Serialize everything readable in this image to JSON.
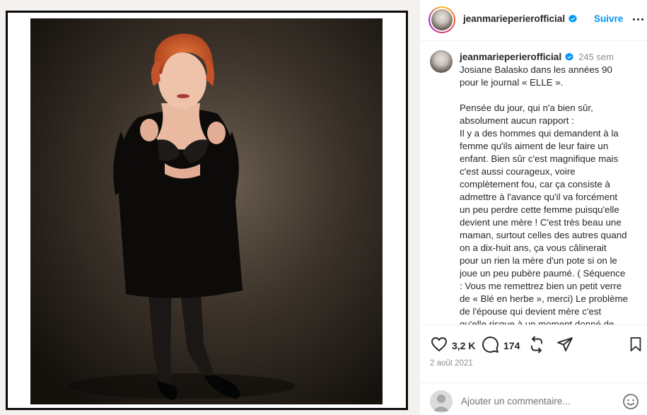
{
  "post": {
    "username": "jeanmarieperierofficial",
    "follow_label": "Suivre",
    "time_ago": "245 sem",
    "caption_lines": [
      "Josiane Balasko dans les années 90",
      "pour le journal « ELLE ».",
      "",
      "Pensée du jour, qui n'a bien sûr,",
      "absolument aucun rapport :",
      "Il y a des hommes qui demandent à la",
      "femme qu'ils aiment de leur faire un",
      "enfant. Bien sûr c'est magnifique mais",
      "c'est aussi courageux, voire",
      "complètement fou, car ça consiste à",
      "admettre à l'avance qu'il va forcément",
      "un peu perdre cette femme puisqu'elle",
      "devient une mère ! C'est très beau une",
      "maman, surtout celles des autres quand",
      "on a dix-huit ans, ça vous câlinerait",
      "pour un rien la mère d'un pote si on le",
      "joue un peu pubère paumé. ( Séquence",
      ": Vous me remettrez bien un petit verre",
      "de « Blé en herbe », merci) Le problème",
      "de l'épouse qui devient mère c'est",
      "qu'elle risque à un moment donné de"
    ],
    "likes": "3,2 K",
    "comments": "174",
    "date": "2 août 2021",
    "comment_placeholder": "Ajouter un commentaire..."
  },
  "icons": {
    "verified": "verified-badge-icon",
    "like": "heart-icon",
    "comment": "comment-icon",
    "repost": "repost-icon",
    "share": "share-icon",
    "save": "bookmark-icon",
    "emoji": "emoji-icon",
    "more": "more-options-icon"
  },
  "colors": {
    "accent": "#0095f6",
    "muted": "#8e8e8e",
    "text": "#262626"
  }
}
